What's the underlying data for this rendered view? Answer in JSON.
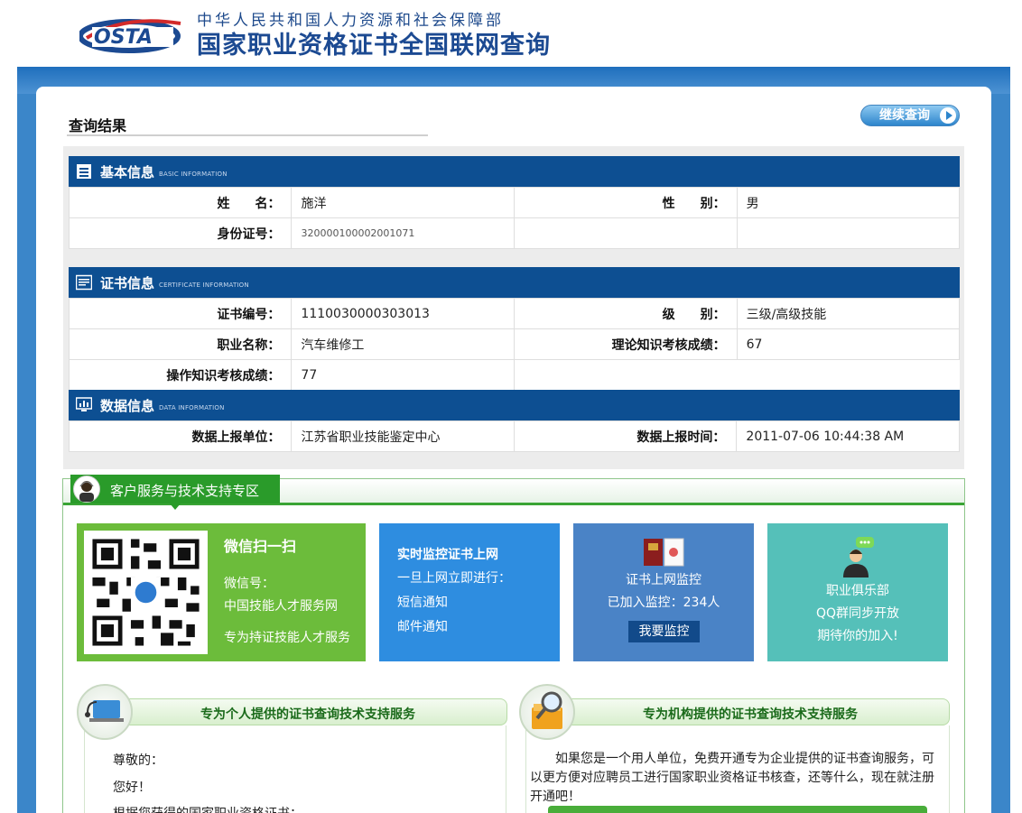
{
  "header": {
    "logo_text": "OSTA",
    "org_line1": "中华人民共和国人力资源和社会保障部",
    "org_line2": "国家职业资格证书全国联网查询"
  },
  "result": {
    "title": "查询结果",
    "continue_label": "继续查询"
  },
  "basic": {
    "title": "基本信息",
    "title_en": "BASIC INFORMATION",
    "name_label": "姓　　名：",
    "name_value": "施洋",
    "gender_label": "性　　别：",
    "gender_value": "男",
    "id_label": "身份证号：",
    "id_value": "320000100002001071"
  },
  "certificate": {
    "title": "证书信息",
    "title_en": "CERTIFICATE INFORMATION",
    "no_label": "证书编号：",
    "no_value": "1110030000303013",
    "level_label": "级　　别：",
    "level_value": "三级/高级技能",
    "occupation_label": "职业名称：",
    "occupation_value": "汽车维修工",
    "theory_label": "理论知识考核成绩：",
    "theory_value": "67",
    "practice_label": "操作知识考核成绩：",
    "practice_value": "77"
  },
  "data_info": {
    "title": "数据信息",
    "title_en": "DATA INFORMATION",
    "unit_label": "数据上报单位：",
    "unit_value": "江苏省职业技能鉴定中心",
    "time_label": "数据上报时间：",
    "time_value": "2011-07-06 10:44:38 AM"
  },
  "support": {
    "tab_label": "客户服务与技术支持专区",
    "wechat": {
      "title": "微信扫一扫",
      "line1": "微信号：",
      "line2": "中国技能人才服务网",
      "line3": "专为持证技能人才服务"
    },
    "monitor": {
      "title": "实时监控证书上网",
      "line1": "一旦上网立即进行：",
      "line2": "短信通知",
      "line3": "邮件通知"
    },
    "cert_monitor": {
      "line1": "证书上网监控",
      "line2": "已加入监控：234人",
      "button": "我要监控"
    },
    "club": {
      "line1": "职业俱乐部",
      "line2": "QQ群同步开放",
      "line3": "期待你的加入!"
    }
  },
  "services": {
    "personal_title": "专为个人提供的证书查询技术支持服务",
    "personal_l1": "尊敬的：",
    "personal_l2": "您好！",
    "personal_l3": "根据您获得的国家职业资格证书：",
    "org_title": "专为机构提供的证书查询技术支持服务",
    "org_text": "　　如果您是一个用人单位，免费开通专为企业提供的证书查询服务，可以更方便对应聘员工进行国家职业资格证书核查，还等什么，现在就注册开通吧！"
  },
  "colors": {
    "brand_blue": "#0d4f92",
    "support_green": "#2a9b2a"
  }
}
